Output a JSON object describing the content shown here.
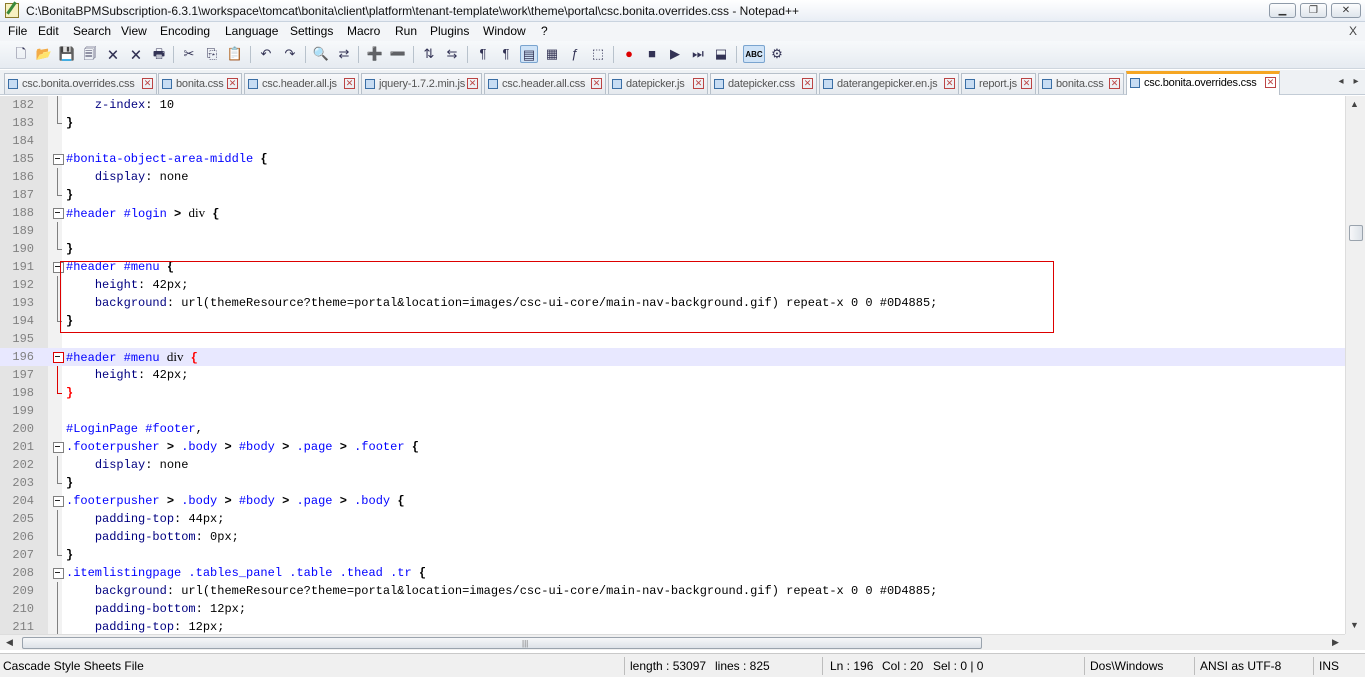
{
  "window": {
    "title": "C:\\BonitaBPMSubscription-6.3.1\\workspace\\tomcat\\bonita\\client\\platform\\tenant-template\\work\\theme\\portal\\csc.bonita.overrides.css - Notepad++",
    "minimize": "▁",
    "maximize": "❐",
    "close": "✕"
  },
  "menu": {
    "items": [
      "File",
      "Edit",
      "Search",
      "View",
      "Encoding",
      "Language",
      "Settings",
      "Macro",
      "Run",
      "Plugins",
      "Window",
      "?"
    ],
    "close_doc": "X"
  },
  "toolbar": {
    "icons": [
      "new-file-icon",
      "open-file-icon",
      "save-icon",
      "save-all-icon",
      "close-icon",
      "close-all-icon",
      "print-icon",
      "cut-icon",
      "copy-icon",
      "paste-icon",
      "undo-icon",
      "redo-icon",
      "find-icon",
      "replace-icon",
      "zoom-in-icon",
      "zoom-out-icon",
      "sync-vertical-icon",
      "sync-horizontal-icon",
      "word-wrap-icon",
      "show-all-chars-icon",
      "indent-guide-icon",
      "user-language-icon",
      "function-list-icon",
      "doc-map-icon",
      "record-macro-icon",
      "stop-record-icon",
      "playback-macro-icon",
      "run-macro-multiple-icon",
      "save-macro-icon",
      "spell-check-icon",
      "plugin-icon"
    ],
    "glyphs": [
      "🗋",
      "📂",
      "💾",
      "🗐",
      "🗙",
      "🗙",
      "🖶",
      "✂",
      "⎘",
      "📋",
      "↶",
      "↷",
      "🔍",
      "⇄",
      "➕",
      "➖",
      "⇅",
      "⇆",
      "¶",
      "¶",
      "▤",
      "▦",
      "ƒ",
      "⬚",
      "●",
      "■",
      "▶",
      "⏭",
      "⬓",
      "ABC",
      "⚙"
    ]
  },
  "tabs": [
    {
      "label": "csc.bonita.overrides.css",
      "active": false
    },
    {
      "label": "bonita.css",
      "active": false
    },
    {
      "label": "csc.header.all.js",
      "active": false
    },
    {
      "label": "jquery-1.7.2.min.js",
      "active": false
    },
    {
      "label": "csc.header.all.css",
      "active": false
    },
    {
      "label": "datepicker.js",
      "active": false
    },
    {
      "label": "datepicker.css",
      "active": false
    },
    {
      "label": "daterangepicker.en.js",
      "active": false
    },
    {
      "label": "report.js",
      "active": false
    },
    {
      "label": "bonita.css",
      "active": false
    },
    {
      "label": "csc.bonita.overrides.css",
      "active": true
    }
  ],
  "tab_close": "✕",
  "tab_nav": {
    "left": "◂",
    "right": "▸"
  },
  "editor": {
    "lines": [
      {
        "n": "182",
        "tokens": [
          [
            "    ",
            ""
          ],
          [
            "z-index",
            "prop"
          ],
          [
            ": ",
            ""
          ],
          [
            "10",
            "val-n"
          ]
        ]
      },
      {
        "n": "183",
        "tokens": [
          [
            "}",
            "brace"
          ]
        ]
      },
      {
        "n": "184",
        "tokens": []
      },
      {
        "n": "185",
        "tokens": [
          [
            "#bonita-object-area-middle",
            "sel"
          ],
          [
            " {",
            "brace"
          ]
        ]
      },
      {
        "n": "186",
        "tokens": [
          [
            "    ",
            ""
          ],
          [
            "display",
            "prop"
          ],
          [
            ": ",
            ""
          ],
          [
            "none",
            "val-n"
          ]
        ]
      },
      {
        "n": "187",
        "tokens": [
          [
            "}",
            "brace"
          ]
        ]
      },
      {
        "n": "188",
        "tokens": [
          [
            "#header",
            "sel"
          ],
          [
            " ",
            ""
          ],
          [
            "#login",
            "sel"
          ],
          [
            " > ",
            "brace"
          ],
          [
            "div",
            "tagname"
          ],
          [
            " {",
            "brace"
          ]
        ]
      },
      {
        "n": "189",
        "tokens": []
      },
      {
        "n": "190",
        "tokens": [
          [
            "}",
            "brace"
          ]
        ]
      },
      {
        "n": "191",
        "tokens": [
          [
            "#header",
            "sel"
          ],
          [
            " ",
            ""
          ],
          [
            "#menu",
            "sel"
          ],
          [
            " {",
            "brace"
          ]
        ]
      },
      {
        "n": "192",
        "tokens": [
          [
            "    ",
            ""
          ],
          [
            "height",
            "prop"
          ],
          [
            ": ",
            ""
          ],
          [
            "42px;",
            "val-n"
          ]
        ]
      },
      {
        "n": "193",
        "tokens": [
          [
            "    ",
            ""
          ],
          [
            "background",
            "prop"
          ],
          [
            ": ",
            ""
          ],
          [
            "url(themeResource?theme=portal&location=images/csc-ui-core/main-nav-background.gif) repeat-x 0 0 #0D4885;",
            "val-n"
          ]
        ]
      },
      {
        "n": "194",
        "tokens": [
          [
            "}",
            "brace"
          ]
        ]
      },
      {
        "n": "195",
        "tokens": []
      },
      {
        "n": "196",
        "tokens": [
          [
            "#header",
            "sel"
          ],
          [
            " ",
            ""
          ],
          [
            "#menu",
            "sel"
          ],
          [
            " ",
            ""
          ],
          [
            "div",
            "tagname"
          ],
          [
            " {",
            "brace-hl"
          ]
        ]
      },
      {
        "n": "197",
        "tokens": [
          [
            "    ",
            ""
          ],
          [
            "height",
            "prop"
          ],
          [
            ": ",
            ""
          ],
          [
            "42px;",
            "val-n"
          ]
        ]
      },
      {
        "n": "198",
        "tokens": [
          [
            "}",
            "brace-hl"
          ]
        ]
      },
      {
        "n": "199",
        "tokens": []
      },
      {
        "n": "200",
        "tokens": [
          [
            "#LoginPage",
            "sel"
          ],
          [
            " ",
            ""
          ],
          [
            "#footer",
            "sel"
          ],
          [
            ",",
            ""
          ]
        ]
      },
      {
        "n": "201",
        "tokens": [
          [
            ".footerpusher",
            "sel"
          ],
          [
            " > ",
            "brace"
          ],
          [
            ".body",
            "sel"
          ],
          [
            " > ",
            "brace"
          ],
          [
            "#body",
            "sel"
          ],
          [
            " > ",
            "brace"
          ],
          [
            ".page",
            "sel"
          ],
          [
            " > ",
            "brace"
          ],
          [
            ".footer",
            "sel"
          ],
          [
            " {",
            "brace"
          ]
        ]
      },
      {
        "n": "202",
        "tokens": [
          [
            "    ",
            ""
          ],
          [
            "display",
            "prop"
          ],
          [
            ": ",
            ""
          ],
          [
            "none",
            "val-n"
          ]
        ]
      },
      {
        "n": "203",
        "tokens": [
          [
            "}",
            "brace"
          ]
        ]
      },
      {
        "n": "204",
        "tokens": [
          [
            ".footerpusher",
            "sel"
          ],
          [
            " > ",
            "brace"
          ],
          [
            ".body",
            "sel"
          ],
          [
            " > ",
            "brace"
          ],
          [
            "#body",
            "sel"
          ],
          [
            " > ",
            "brace"
          ],
          [
            ".page",
            "sel"
          ],
          [
            " > ",
            "brace"
          ],
          [
            ".body",
            "sel"
          ],
          [
            " {",
            "brace"
          ]
        ]
      },
      {
        "n": "205",
        "tokens": [
          [
            "    ",
            ""
          ],
          [
            "padding-top",
            "prop"
          ],
          [
            ": ",
            ""
          ],
          [
            "44px;",
            "val-n"
          ]
        ]
      },
      {
        "n": "206",
        "tokens": [
          [
            "    ",
            ""
          ],
          [
            "padding-bottom",
            "prop"
          ],
          [
            ": ",
            ""
          ],
          [
            "0px;",
            "val-n"
          ]
        ]
      },
      {
        "n": "207",
        "tokens": [
          [
            "}",
            "brace"
          ]
        ]
      },
      {
        "n": "208",
        "tokens": [
          [
            ".itemlistingpage",
            "sel"
          ],
          [
            " ",
            ""
          ],
          [
            ".tables_panel",
            "sel"
          ],
          [
            " ",
            ""
          ],
          [
            ".table",
            "sel"
          ],
          [
            " ",
            ""
          ],
          [
            ".thead",
            "sel"
          ],
          [
            " ",
            ""
          ],
          [
            ".tr",
            "sel"
          ],
          [
            " {",
            "brace"
          ]
        ]
      },
      {
        "n": "209",
        "tokens": [
          [
            "    ",
            ""
          ],
          [
            "background",
            "prop"
          ],
          [
            ": ",
            ""
          ],
          [
            "url(themeResource?theme=portal&location=images/csc-ui-core/main-nav-background.gif) repeat-x 0 0 #0D4885;",
            "val-n"
          ]
        ]
      },
      {
        "n": "210",
        "tokens": [
          [
            "    ",
            ""
          ],
          [
            "padding-bottom",
            "prop"
          ],
          [
            ": ",
            ""
          ],
          [
            "12px;",
            "val-n"
          ]
        ]
      },
      {
        "n": "211",
        "tokens": [
          [
            "    ",
            ""
          ],
          [
            "padding-top",
            "prop"
          ],
          [
            ": ",
            ""
          ],
          [
            "12px;",
            "val-n"
          ]
        ]
      }
    ],
    "current_line": "196",
    "folds": {
      "182": "vline",
      "183": "end",
      "184": "",
      "185": "box",
      "186": "vline",
      "187": "end",
      "188": "box",
      "189": "vline",
      "190": "end",
      "191": "box",
      "192": "vline",
      "193": "vline",
      "194": "end",
      "195": "",
      "196": "box red",
      "197": "vline red",
      "198": "end red",
      "199": "",
      "200": "",
      "201": "box",
      "202": "vline",
      "203": "end",
      "204": "box",
      "205": "vline",
      "206": "vline",
      "207": "end",
      "208": "box",
      "209": "vline",
      "210": "vline",
      "211": "vline"
    }
  },
  "scrollbars": {
    "up": "▲",
    "down": "▼",
    "left": "◀",
    "right": "▶",
    "grip": "|||"
  },
  "status": {
    "file_type": "Cascade Style Sheets File",
    "length": "length : 53097",
    "lines": "lines : 825",
    "ln": "Ln : 196",
    "col": "Col : 20",
    "sel": "Sel : 0 | 0",
    "eol": "Dos\\Windows",
    "encoding": "ANSI as UTF-8",
    "mode": "INS"
  },
  "colors": {
    "accent_tab": "#f5a623",
    "highlight_box": "#dd0000",
    "selector": "#0000ff",
    "property": "#000080"
  }
}
